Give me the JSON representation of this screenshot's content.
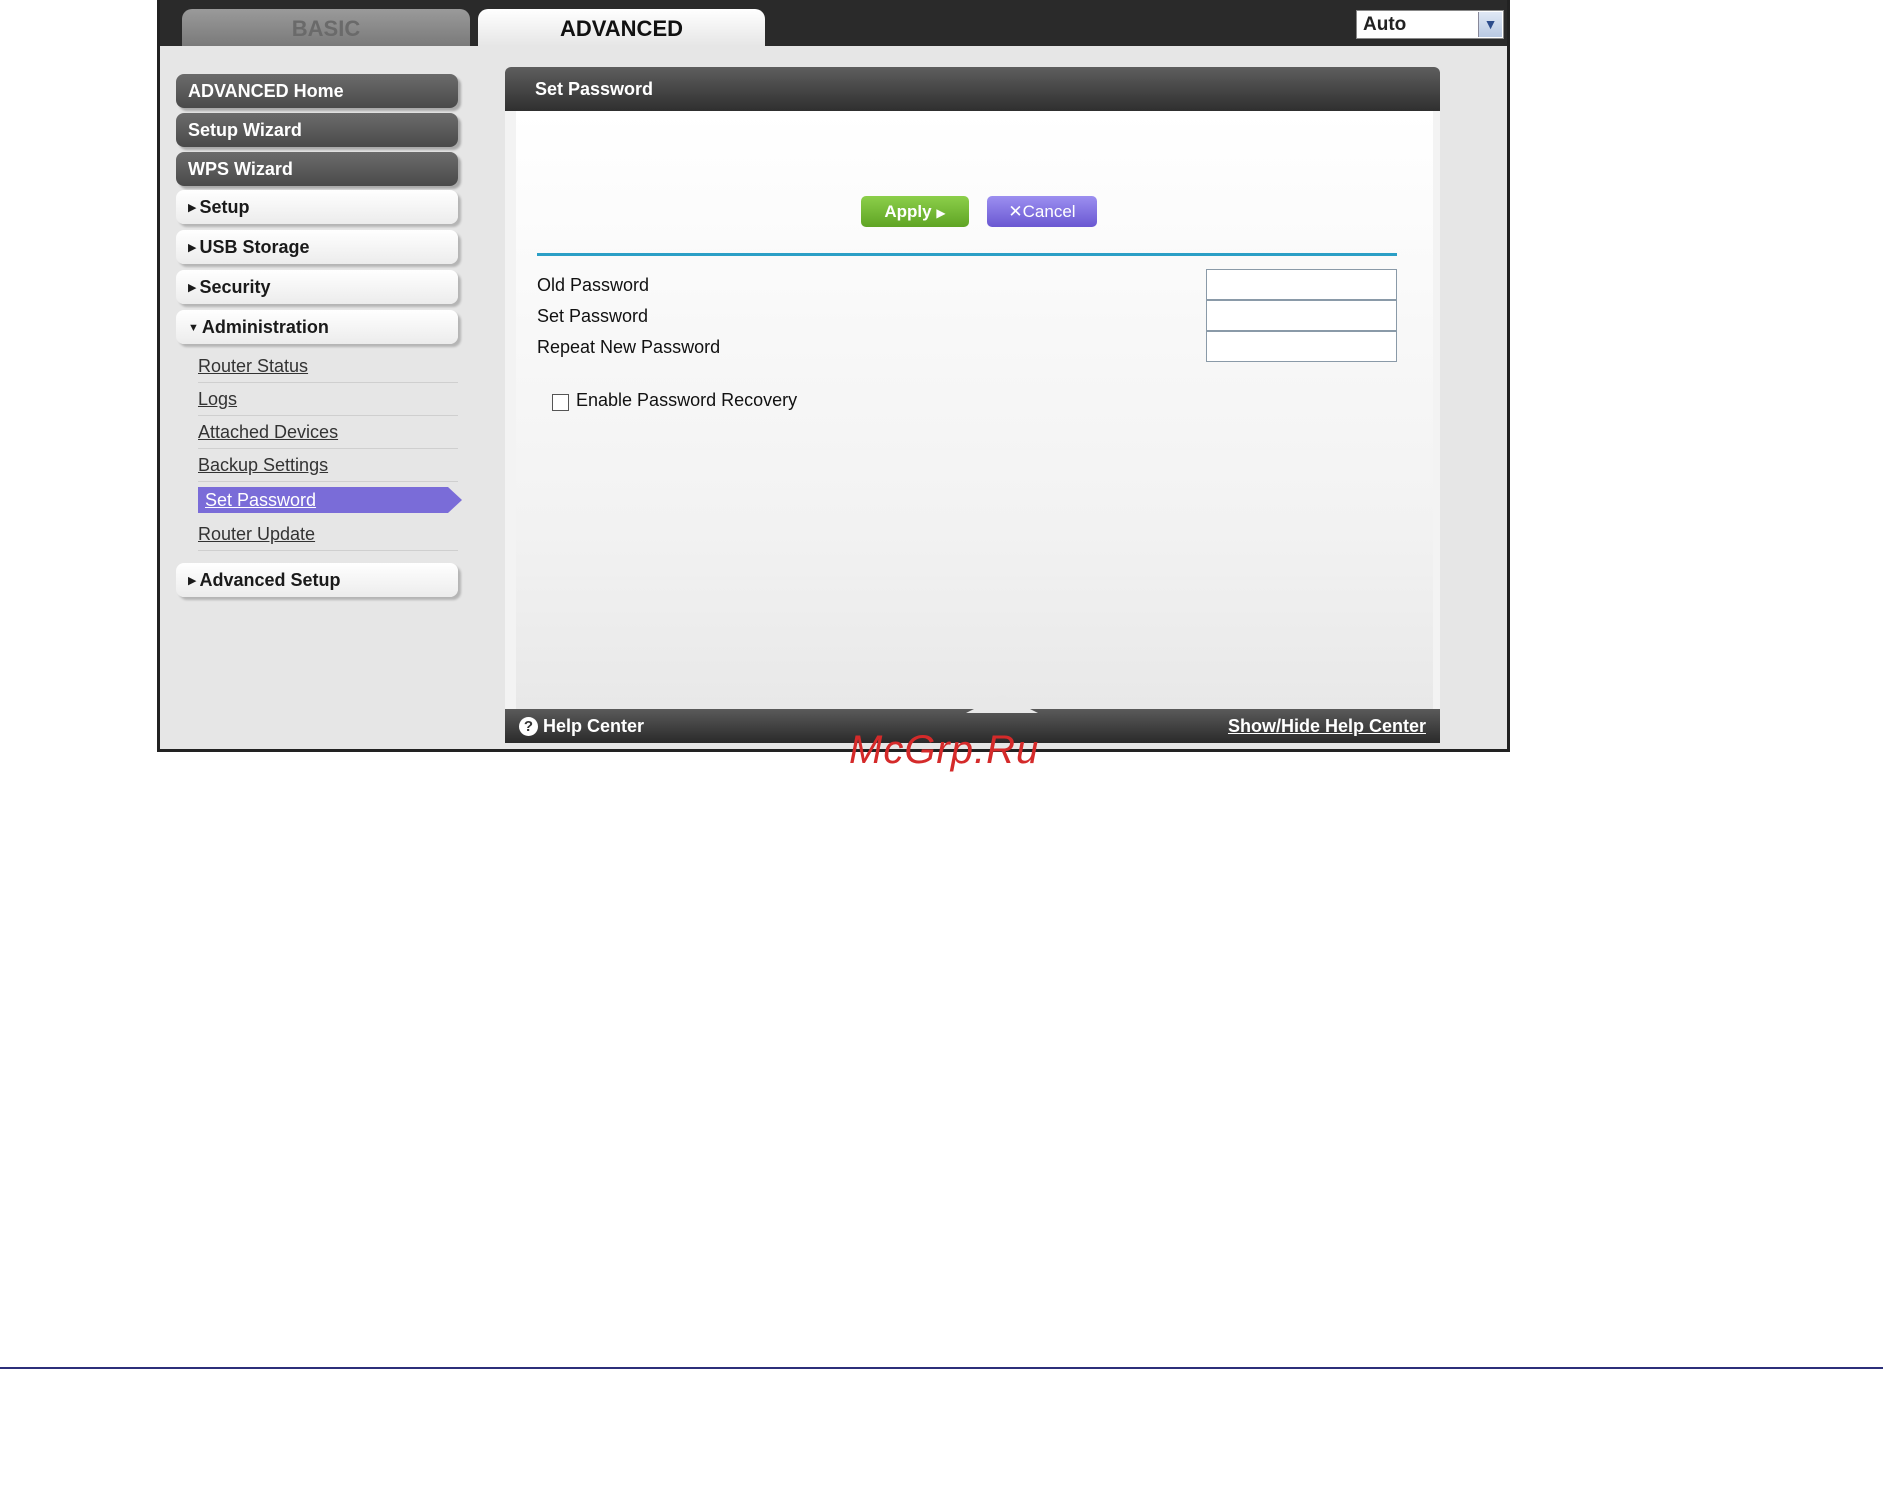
{
  "tabs": {
    "basic": "BASIC",
    "advanced": "ADVANCED"
  },
  "language": {
    "selected": "Auto"
  },
  "sidebar": {
    "main_items": [
      "ADVANCED Home",
      "Setup Wizard",
      "WPS Wizard"
    ],
    "sections": [
      "Setup",
      "USB Storage",
      "Security",
      "Administration"
    ],
    "admin_items": [
      "Router Status",
      "Logs",
      "Attached Devices",
      "Backup Settings",
      "Set Password",
      "Router Update"
    ],
    "advanced_setup": "Advanced Setup"
  },
  "panel": {
    "title": "Set Password",
    "apply": "Apply",
    "cancel": "Cancel",
    "fields": [
      "Old Password",
      "Set Password",
      "Repeat New Password"
    ],
    "checkbox_label": "Enable Password Recovery"
  },
  "footer": {
    "help": "Help Center",
    "toggle": "Show/Hide Help Center"
  },
  "watermark": "McGrp.Ru",
  "colors": {
    "accent_purple": "#7a6cd8",
    "apply_green": "#6db52f",
    "separator_blue": "#2b9fc6"
  }
}
